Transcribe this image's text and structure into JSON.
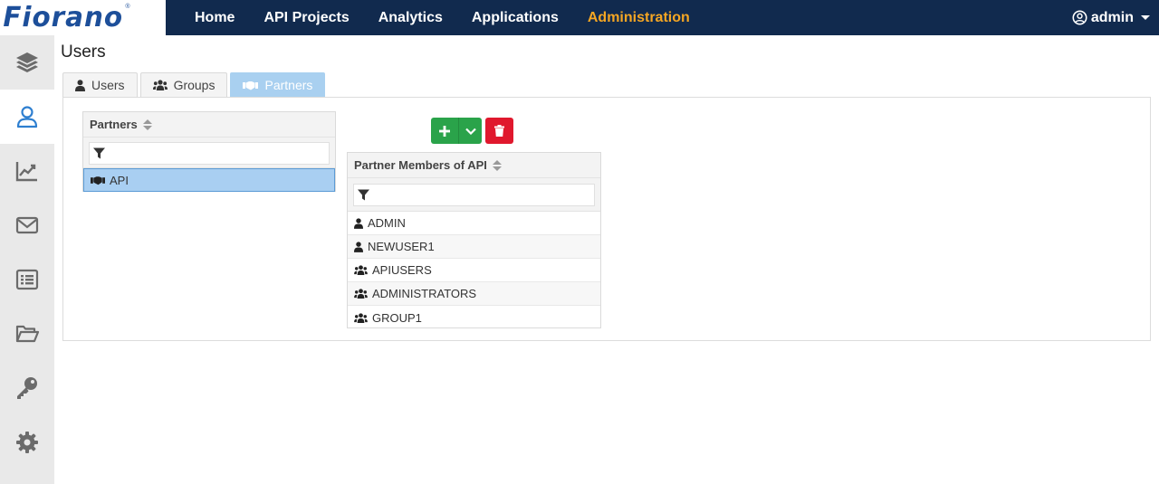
{
  "brand": {
    "logo_text": "Fiorano",
    "reg_mark": "®"
  },
  "nav": {
    "items": [
      {
        "label": "Home",
        "active": false
      },
      {
        "label": "API Projects",
        "active": false
      },
      {
        "label": "Analytics",
        "active": false
      },
      {
        "label": "Applications",
        "active": false
      },
      {
        "label": "Administration",
        "active": true
      }
    ]
  },
  "user_menu": {
    "username": "admin",
    "icon": "user-circle-icon"
  },
  "sidebar": {
    "items": [
      {
        "icon": "layers-icon",
        "active": false
      },
      {
        "icon": "user-icon",
        "active": true
      },
      {
        "icon": "chart-area-icon",
        "active": false
      },
      {
        "icon": "envelope-icon",
        "active": false
      },
      {
        "icon": "list-alt-icon",
        "active": false
      },
      {
        "icon": "folder-open-icon",
        "active": false
      },
      {
        "icon": "key-icon",
        "active": false
      },
      {
        "icon": "gear-icon",
        "active": false
      }
    ]
  },
  "page": {
    "title": "Users"
  },
  "tabs": [
    {
      "label": "Users",
      "icon": "user-icon",
      "active": false
    },
    {
      "label": "Groups",
      "icon": "users-icon",
      "active": false
    },
    {
      "label": "Partners",
      "icon": "handshake-icon",
      "active": true
    }
  ],
  "partners_grid": {
    "header": "Partners",
    "filter_placeholder": "",
    "rows": [
      {
        "label": "API",
        "icon": "handshake-icon",
        "selected": true
      }
    ]
  },
  "toolbar": {
    "add_icon": "plus-icon",
    "dropdown_icon": "chevron-down-icon",
    "delete_icon": "trash-icon"
  },
  "members_grid": {
    "header": "Partner Members of API",
    "filter_placeholder": "",
    "rows": [
      {
        "label": "ADMIN",
        "icon": "user-icon"
      },
      {
        "label": "NEWUSER1",
        "icon": "user-icon"
      },
      {
        "label": "APIUSERS",
        "icon": "users-icon"
      },
      {
        "label": "ADMINISTRATORS",
        "icon": "users-icon"
      },
      {
        "label": "GROUP1",
        "icon": "users-icon"
      }
    ]
  },
  "colors": {
    "topbar": "#112a4e",
    "nav_active": "#f5a623",
    "tab_active": "#a9d0f0",
    "add_button": "#2aa34a",
    "delete_button": "#e0182d",
    "selected_row": "#a9cff2"
  }
}
